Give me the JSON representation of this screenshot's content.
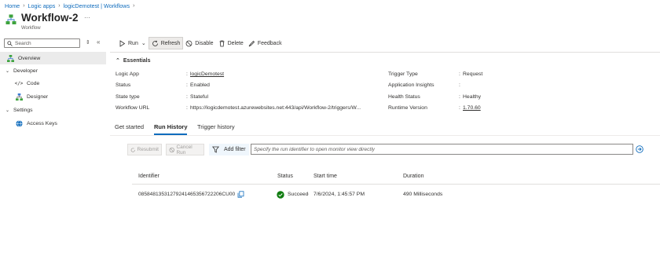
{
  "breadcrumb": [
    "Home",
    "Logic apps",
    "logicDemotest | Workflows"
  ],
  "header": {
    "title": "Workflow-2",
    "subtitle": "Workflow",
    "more": "···"
  },
  "sidebar": {
    "search_placeholder": "Search",
    "collapse_symbol": "⇕",
    "hide_symbol": "«",
    "items": [
      {
        "label": "Overview",
        "icon": "workflow-icon",
        "active": true
      },
      {
        "label": "Developer",
        "icon": "chevron-down-icon",
        "group": true
      },
      {
        "label": "Code",
        "icon": "code-icon"
      },
      {
        "label": "Designer",
        "icon": "designer-icon"
      },
      {
        "label": "Settings",
        "icon": "chevron-down-icon",
        "group": true
      },
      {
        "label": "Access Keys",
        "icon": "globe-icon"
      }
    ]
  },
  "toolbar": {
    "run": "Run",
    "refresh": "Refresh",
    "disable": "Disable",
    "delete": "Delete",
    "feedback": "Feedback"
  },
  "essentials": {
    "header": "Essentials",
    "left": [
      {
        "label": "Logic App",
        "value": "logicDemotest",
        "link": true
      },
      {
        "label": "Status",
        "value": "Enabled"
      },
      {
        "label": "State type",
        "value": "Stateful"
      },
      {
        "label": "Workflow URL",
        "value": "https://logicdemotest.azurewebsites.net:443/api/Workflow-2/triggers/W..."
      }
    ],
    "right": [
      {
        "label": "Trigger Type",
        "value": "Request"
      },
      {
        "label": "Application Insights",
        "value": ""
      },
      {
        "label": "Health Status",
        "value": "Healthy"
      },
      {
        "label": "Runtime Version",
        "value": "1.70.60",
        "link": true
      }
    ]
  },
  "tabs": [
    "Get started",
    "Run History",
    "Trigger history"
  ],
  "run_actions": {
    "resubmit": "Resubmit",
    "cancel_run": "Cancel Run",
    "add_filter": "Add filter",
    "filter_placeholder": "Specify the run identifier to open monitor view directly"
  },
  "table": {
    "columns": [
      "Identifier",
      "Status",
      "Start time",
      "Duration"
    ],
    "rows": [
      {
        "identifier": "08584813531279241465356722206CU00",
        "status": "Succeede",
        "start_time": "7/6/2024, 1:45:57 PM",
        "duration": "490 Milliseconds"
      }
    ]
  },
  "colors": {
    "accent": "#0f6cbd",
    "success": "#107c10"
  }
}
